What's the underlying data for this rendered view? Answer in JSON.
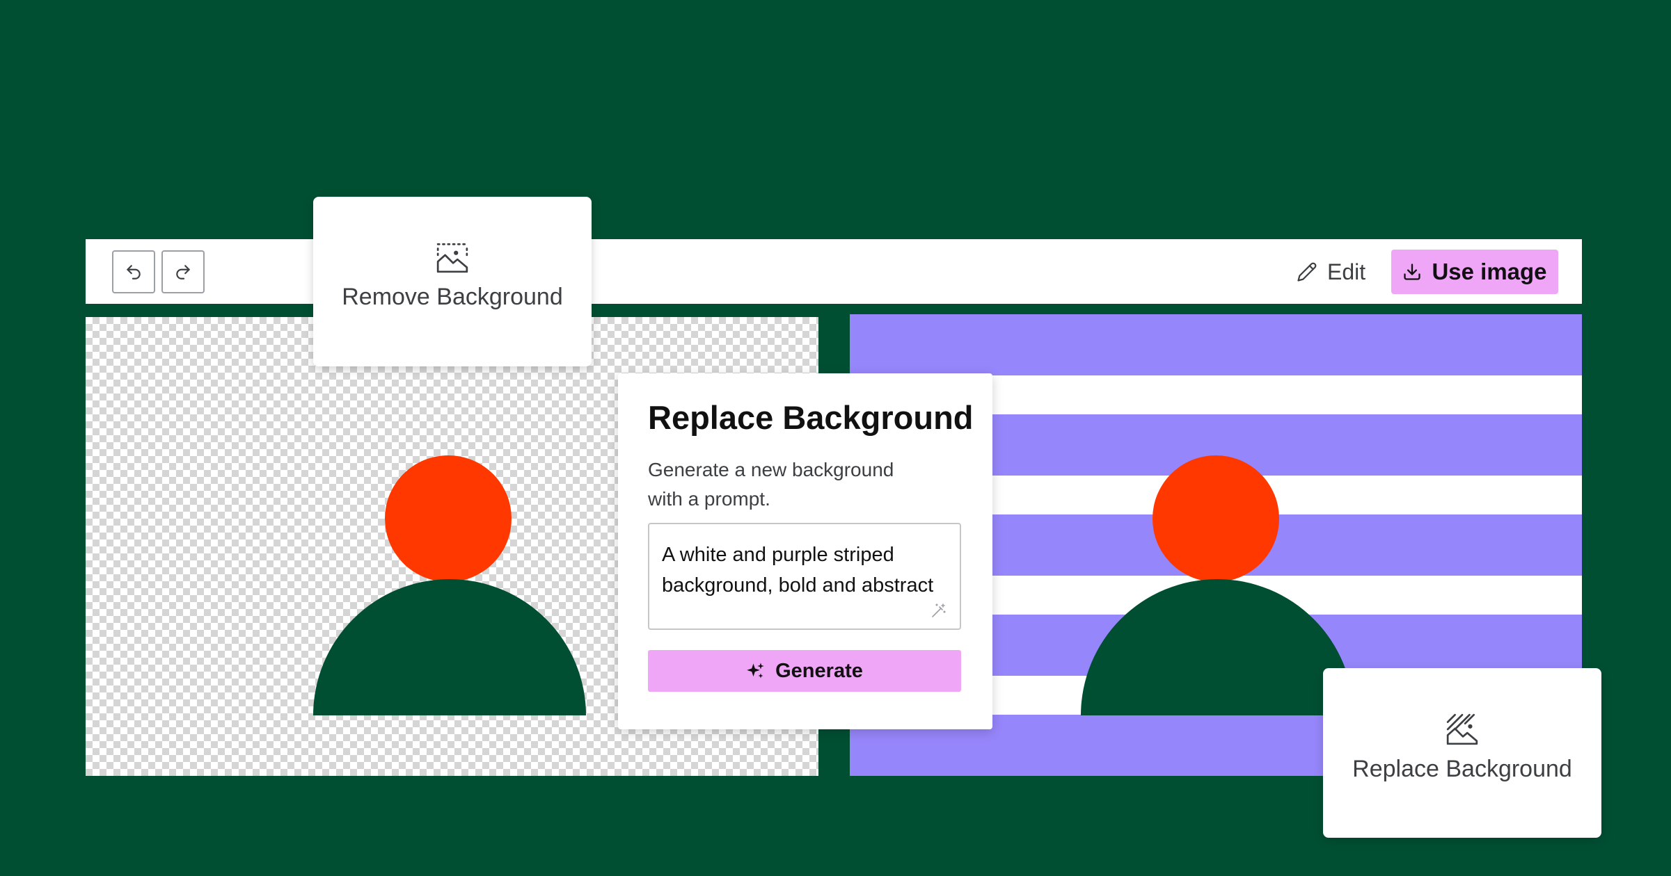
{
  "toolbar": {
    "undo_icon": "undo-icon",
    "redo_icon": "redo-icon",
    "edit_label": "Edit",
    "edit_icon": "pencil-icon",
    "use_image_label": "Use image",
    "use_image_icon": "download-icon"
  },
  "remove_background_card": {
    "label": "Remove Background",
    "icon": "remove-background-icon"
  },
  "replace_background_card": {
    "label": "Replace Background",
    "icon": "replace-background-icon"
  },
  "replace_dialog": {
    "title": "Replace Background",
    "description": "Generate a new background with a prompt.",
    "prompt_value": "A white and purple striped background, bold and abstract",
    "prompt_icon": "magic-wand-icon",
    "generate_label": "Generate",
    "generate_icon": "sparkle-icon"
  },
  "colors": {
    "page_background": "#014f33",
    "accent": "#efa6f7",
    "stripe_purple": "#9686fb",
    "avatar_head": "#ff3800",
    "avatar_body": "#014f33"
  }
}
